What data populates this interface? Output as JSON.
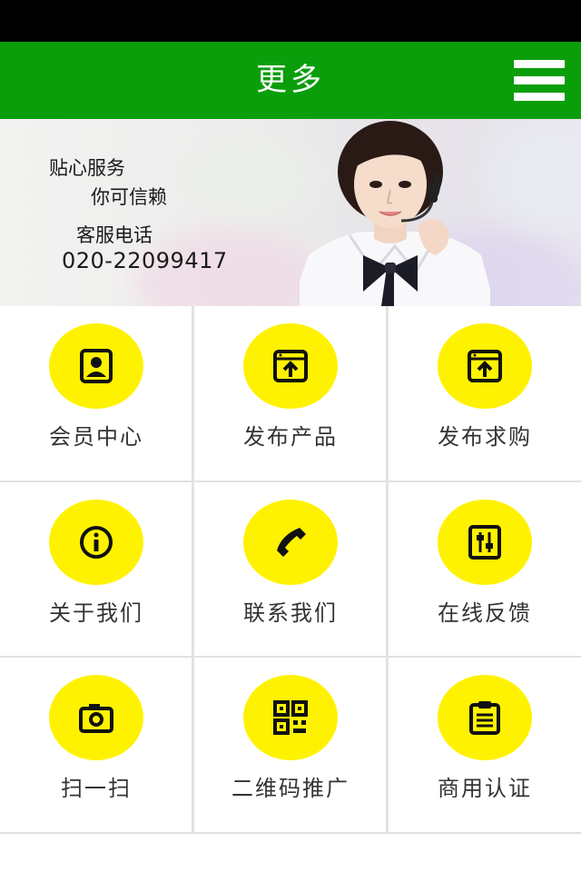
{
  "header": {
    "title": "更多",
    "menu_icon": "hamburger-menu-icon"
  },
  "banner": {
    "tagline_1": "贴心服务",
    "tagline_2": "你可信赖",
    "hotline_label": "客服电话",
    "hotline_number": "020-22099417"
  },
  "menu": {
    "accent_color": "#fff200",
    "header_color": "#0a9e0a",
    "items": [
      {
        "label": "会员中心",
        "icon": "member-profile-icon"
      },
      {
        "label": "发布产品",
        "icon": "upload-window-icon"
      },
      {
        "label": "发布求购",
        "icon": "upload-window-icon"
      },
      {
        "label": "关于我们",
        "icon": "info-icon"
      },
      {
        "label": "联系我们",
        "icon": "phone-icon"
      },
      {
        "label": "在线反馈",
        "icon": "feedback-sliders-icon"
      },
      {
        "label": "扫一扫",
        "icon": "camera-icon"
      },
      {
        "label": "二维码推广",
        "icon": "qr-code-icon"
      },
      {
        "label": "商用认证",
        "icon": "clipboard-icon"
      }
    ]
  }
}
